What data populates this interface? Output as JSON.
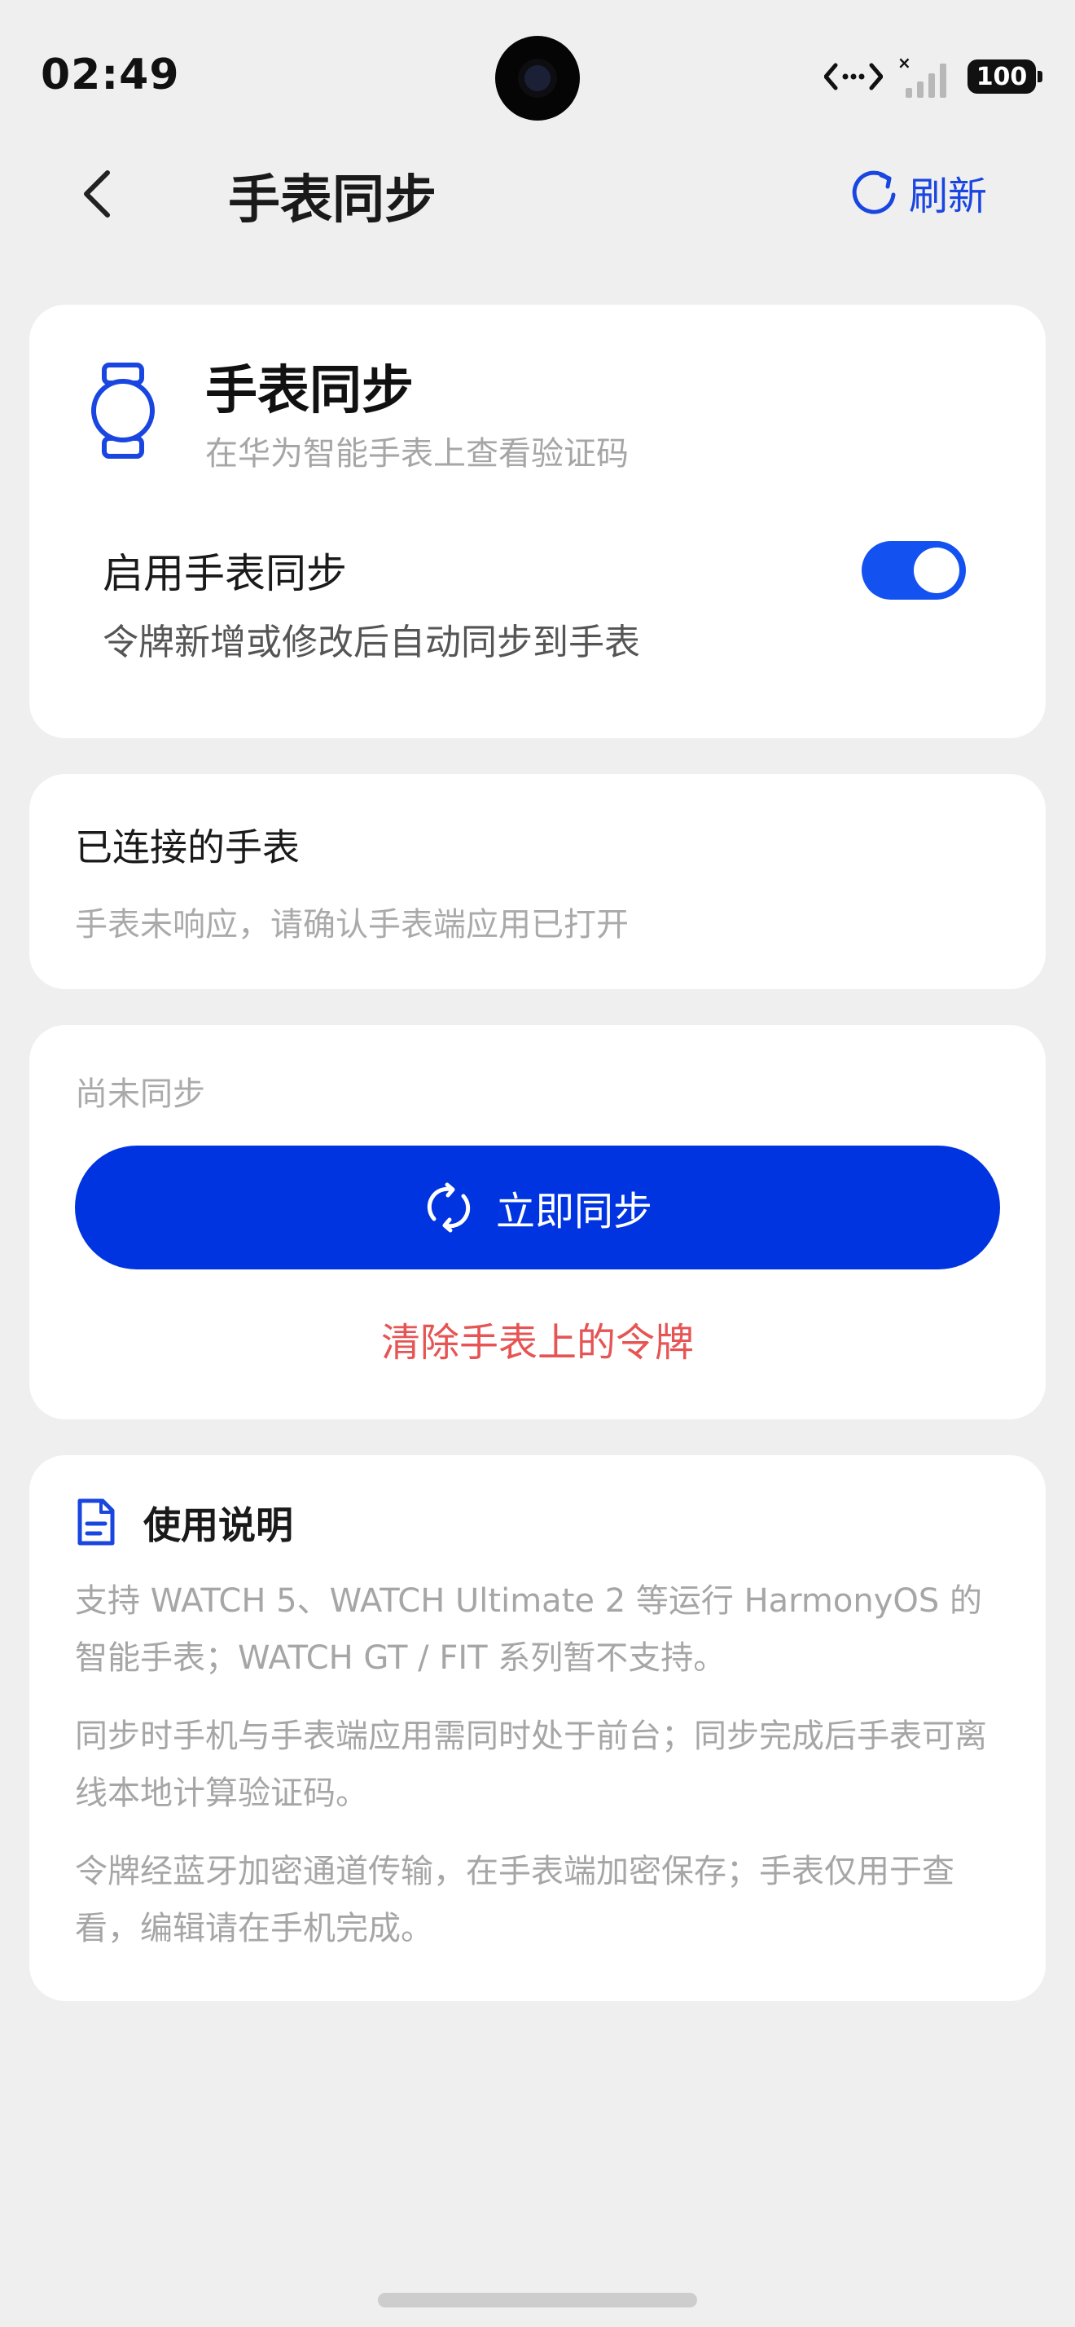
{
  "status_bar": {
    "time": "02:49",
    "battery": "100"
  },
  "header": {
    "title": "手表同步",
    "refresh_label": "刷新"
  },
  "watch_card": {
    "title": "手表同步",
    "subtitle": "在华为智能手表上查看验证码",
    "toggle_label": "启用手表同步",
    "toggle_desc": "令牌新增或修改后自动同步到手表",
    "toggle_on": true
  },
  "connected_card": {
    "title": "已连接的手表",
    "hint": "手表未响应，请确认手表端应用已打开"
  },
  "sync_card": {
    "status": "尚未同步",
    "sync_button_label": "立即同步",
    "clear_label": "清除手表上的令牌"
  },
  "help_card": {
    "title": "使用说明",
    "paragraphs": [
      "支持 WATCH 5、WATCH Ultimate 2 等运行 HarmonyOS 的智能手表；WATCH GT / FIT 系列暂不支持。",
      "同步时手机与手表端应用需同时处于前台；同步完成后手表可离线本地计算验证码。",
      "令牌经蓝牙加密通道传输，在手表端加密保存；手表仅用于查看，编辑请在手机完成。"
    ]
  },
  "colors": {
    "accent": "#1946e0",
    "button": "#0034e0",
    "toggle": "#1351f0",
    "danger": "#e65454",
    "background": "#efefef"
  }
}
